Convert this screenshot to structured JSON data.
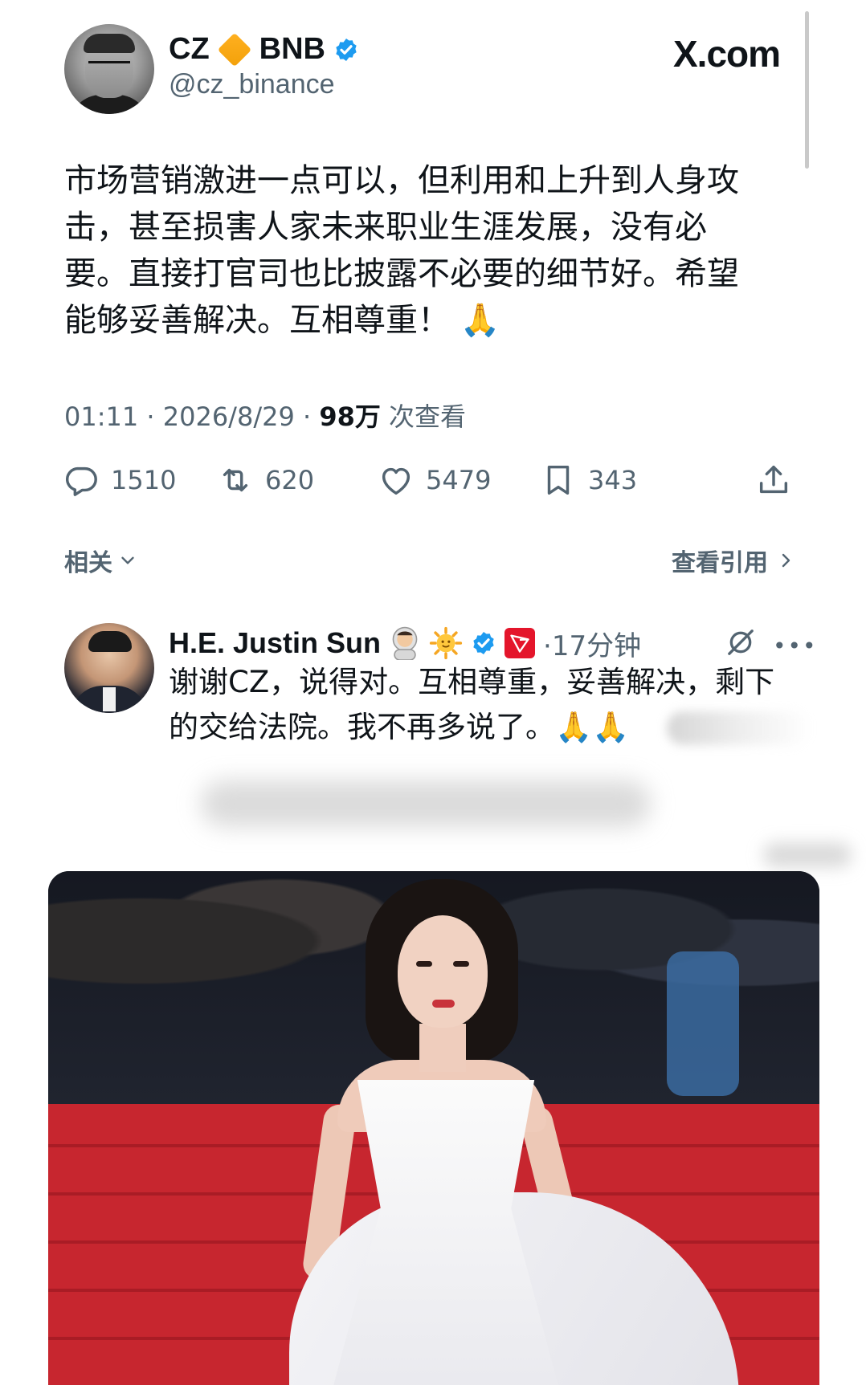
{
  "main_tweet": {
    "display_name": "CZ",
    "name_suffix": "BNB",
    "handle": "@cz_binance",
    "site_label": "X.com",
    "lines": [
      "市场营销激进一点可以，但利用和上升到人身攻",
      "击，甚至损害人家未来职业生涯发展，没有必",
      "要。直接打官司也比披露不必要的细节好。希望",
      "能够妥善解决。互相尊重！"
    ],
    "end_emoji": "🙏",
    "time": "01:11",
    "date": "2026/8/29",
    "views_count": "98万",
    "views_label": "次查看",
    "actions": {
      "replies": "1510",
      "reposts": "620",
      "likes": "5479",
      "bookmarks": "343"
    },
    "related_label": "相关",
    "quotes_label": "查看引用"
  },
  "reply": {
    "display_name": "H.E. Justin Sun",
    "time": "17分钟",
    "lines": [
      "谢谢CZ，说得对。互相尊重，妥善解决，剩下",
      "的交给法院。我不再多说了。"
    ],
    "end_emoji": "🙏🙏"
  },
  "colors": {
    "text_primary": "#0f1419",
    "text_secondary": "#536471",
    "verified_blue": "#1d9bf0",
    "bnb_orange": "#f3a10a",
    "tron_red": "#e4152b",
    "carpet_red": "#c7262f"
  },
  "icons": [
    "verified-badge-icon",
    "bnb-diamond-icon",
    "reply-icon",
    "repost-icon",
    "like-icon",
    "bookmark-icon",
    "share-icon",
    "chevron-down-icon",
    "chevron-right-icon",
    "grok-icon",
    "more-icon",
    "tron-icon",
    "astronaut-icon",
    "sun-icon"
  ]
}
